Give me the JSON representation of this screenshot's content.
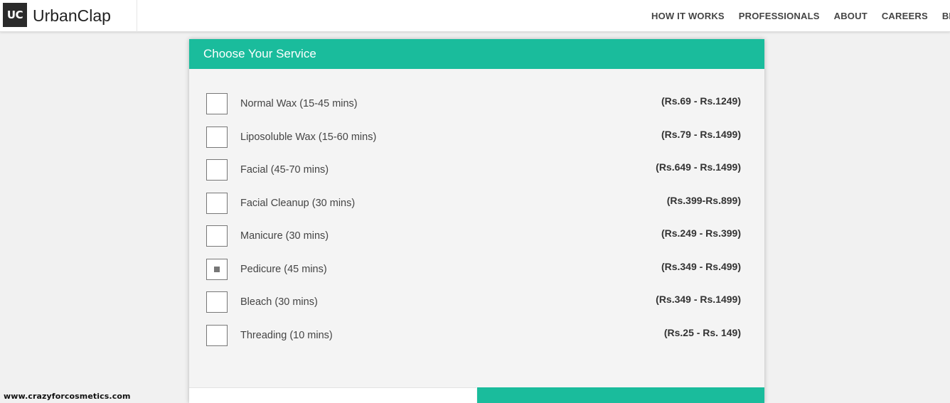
{
  "header": {
    "logo_text": "UC",
    "brand_name": "UrbanClap",
    "nav": [
      "HOW IT WORKS",
      "PROFESSIONALS",
      "ABOUT",
      "CAREERS",
      "BLOG"
    ]
  },
  "panel": {
    "title": "Choose Your Service",
    "services": [
      {
        "name": "Normal Wax (15-45 mins)",
        "price": "(Rs.69 - Rs.1249)",
        "checked": false
      },
      {
        "name": "Liposoluble Wax (15-60 mins)",
        "price": "(Rs.79 - Rs.1499)",
        "checked": false
      },
      {
        "name": "Facial (45-70 mins)",
        "price": "(Rs.649 - Rs.1499)",
        "checked": false
      },
      {
        "name": "Facial Cleanup (30 mins)",
        "price": "(Rs.399-Rs.899)",
        "checked": false
      },
      {
        "name": "Manicure (30 mins)",
        "price": "(Rs.249 - Rs.399)",
        "checked": false
      },
      {
        "name": "Pedicure (45 mins)",
        "price": "(Rs.349 - Rs.499)",
        "checked": true
      },
      {
        "name": "Bleach (30 mins)",
        "price": "(Rs.349 - Rs.1499)",
        "checked": false
      },
      {
        "name": "Threading (10 mins)",
        "price": "(Rs.25 - Rs. 149)",
        "checked": false
      }
    ]
  },
  "colors": {
    "accent": "#1abc9c",
    "logo_bg": "#2b2b2b"
  },
  "watermark": "www.crazyforcosmetics.com"
}
